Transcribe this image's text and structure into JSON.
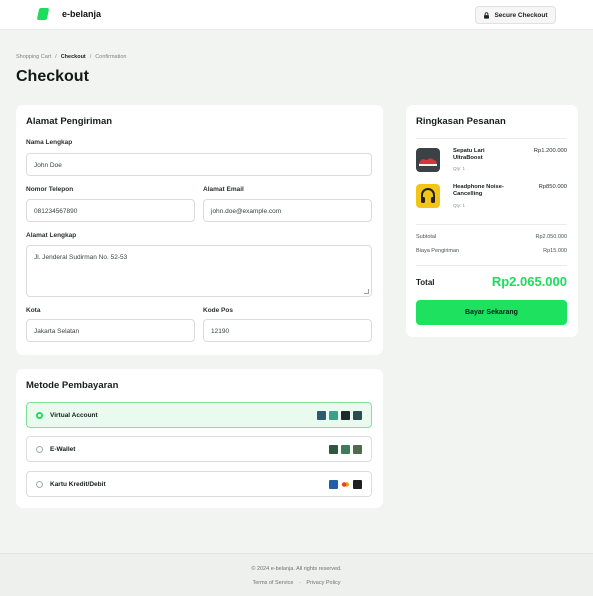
{
  "brand": {
    "name": "e-belanja",
    "accent": "#1ddc5e"
  },
  "header": {
    "secure_label": "Secure Checkout",
    "secure_icon": "lock-icon"
  },
  "breadcrumb": {
    "step1": "Shopping Cart",
    "step2": "Checkout",
    "step3": "Confirmation",
    "sep": "/"
  },
  "page_title": "Checkout",
  "shipping": {
    "title": "Alamat Pengiriman",
    "name_label": "Nama Lengkap",
    "name_value": "John Doe",
    "phone_label": "Nomor Telepon",
    "phone_value": "081234567890",
    "email_label": "Alamat Email",
    "email_value": "john.doe@example.com",
    "address_label": "Alamat Lengkap",
    "address_value": "Jl. Jenderal Sudirman No. 52-53",
    "city_label": "Kota",
    "city_value": "Jakarta Selatan",
    "zip_label": "Kode Pos",
    "zip_value": "12190"
  },
  "payment": {
    "title": "Metode Pembayaran",
    "options": [
      {
        "label": "Virtual Account",
        "selected": true
      },
      {
        "label": "E-Wallet",
        "selected": false
      },
      {
        "label": "Kartu Kredit/Debit",
        "selected": false
      }
    ]
  },
  "summary": {
    "title": "Ringkasan Pesanan",
    "items": [
      {
        "name": "Sepatu Lari UltraBoost",
        "qty": "Qty: 1",
        "price": "Rp1.200.000",
        "icon": "shoe-icon"
      },
      {
        "name": "Headphone Noise-Cancelling",
        "qty": "Qty: 1",
        "price": "Rp850.000",
        "icon": "headphone-icon"
      }
    ],
    "subtotal_label": "Subtotal",
    "subtotal_value": "Rp2.050.000",
    "shipping_label": "Biaya Pengiriman",
    "shipping_value": "Rp15.000",
    "total_label": "Total",
    "total_value": "Rp2.065.000",
    "pay_button": "Bayar Sekarang"
  },
  "footer": {
    "copyright": "© 2024 e-belanja. All rights reserved.",
    "terms": "Terms of Service",
    "dot": "·",
    "privacy": "Privacy Policy"
  }
}
